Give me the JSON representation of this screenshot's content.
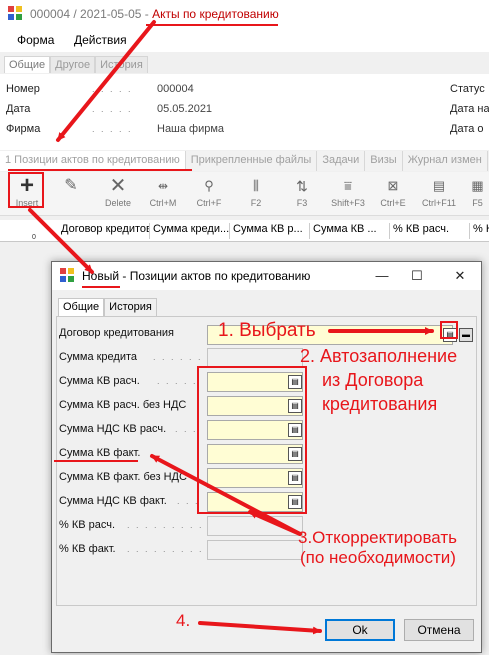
{
  "main_window": {
    "title_prefix": "000004 / 2021-05-05 - ",
    "title_highlight": "Акты по кредитованию",
    "menu": [
      "Форма",
      "Действия"
    ],
    "top_tabs": [
      "Общие",
      "Другое",
      "История"
    ],
    "fields": {
      "number_label": "Номер",
      "number_value": "000004",
      "date_label": "Дата",
      "date_value": "05.05.2021",
      "firm_label": "Фирма",
      "firm_value": "Наша фирма",
      "status_label": "Статус",
      "date_n_label": "Дата на",
      "date_o_label": "Дата о"
    },
    "detail_tabs": [
      "1 Позиции актов по кредитованию",
      "Прикрепленные файлы",
      "Задачи",
      "Визы",
      "Журнал измен"
    ],
    "toolbar": [
      "Insert",
      "",
      "Delete",
      "Ctrl+M",
      "Ctrl+F",
      "F2",
      "F3",
      "Shift+F3",
      "Ctrl+E",
      "Ctrl+F11",
      "F5"
    ],
    "grid_row_number": "0",
    "grid_columns": [
      "Договор кредитов...",
      "Сумма креди...",
      "Сумма КВ р...",
      "Сумма КВ ...",
      "% КВ расч.",
      "% КВ"
    ]
  },
  "dialog": {
    "title_highlight": "Новый",
    "title_rest": " - Позиции актов по кредитованию",
    "tabs": [
      "Общие",
      "История"
    ],
    "fields": [
      "Договор кредитования",
      "Сумма кредита",
      "Сумма КВ расч.",
      "Сумма КВ расч. без НДС",
      "Сумма НДС КВ расч.",
      "Сумма КВ факт.",
      "Сумма КВ факт. без НДС",
      "Сумма НДС КВ факт.",
      "% КВ расч.",
      "% КВ факт."
    ],
    "ok_label": "Ok",
    "cancel_label": "Отмена"
  },
  "annotations": {
    "step1": "1. Выбрать",
    "step2_l1": "2. Автозаполнение",
    "step2_l2": "из Договора",
    "step2_l3": "кредитования",
    "step3_l1": "3.Откорректировать",
    "step3_l2": "(по необходимости)",
    "step4": "4."
  },
  "colors": {
    "annotation": "#e8161b",
    "editable_field": "#fffdd4",
    "primary_button_border": "#0078d7"
  }
}
